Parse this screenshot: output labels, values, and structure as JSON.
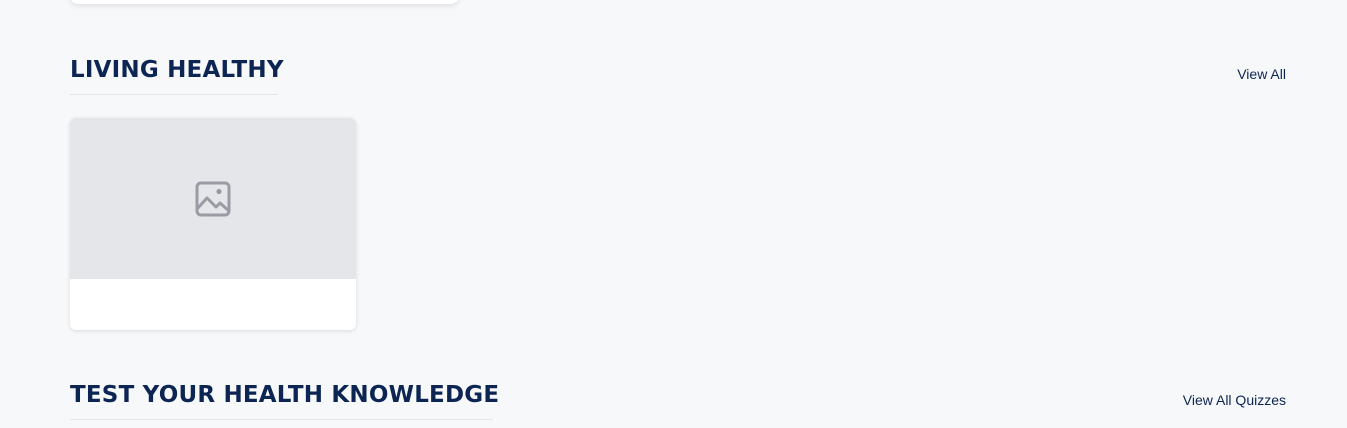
{
  "colors": {
    "background": "#f7f8fa",
    "heading": "#0d2553",
    "image_placeholder": "#e5e6ea",
    "placeholder_icon": "#9a9ca5"
  },
  "sections": [
    {
      "title": "LIVING HEALTHY",
      "link": "View All",
      "cards": [
        {
          "image_icon": "image-placeholder-icon",
          "title": ""
        }
      ]
    },
    {
      "title": "TEST YOUR HEALTH KNOWLEDGE",
      "link": "View All Quizzes"
    }
  ]
}
